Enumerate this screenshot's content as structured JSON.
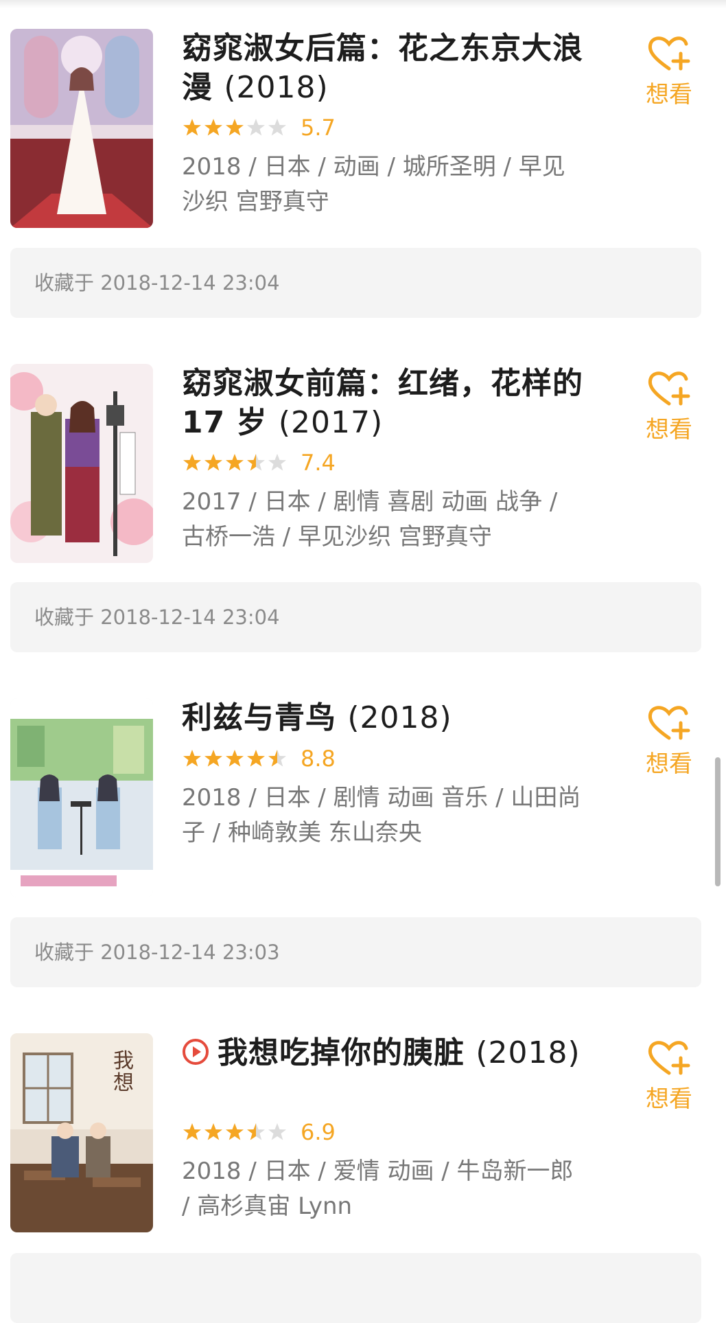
{
  "colors": {
    "accent": "#f5a623",
    "star_empty": "#dcdcdc",
    "play_red": "#e54b3c",
    "collect_bg": "#f4f4f4"
  },
  "icons": {
    "want": "heart-plus-icon",
    "star": "star-icon",
    "play": "play-circle-icon"
  },
  "items": [
    {
      "title": "窈窕淑女后篇：花之东京大浪漫",
      "year": "(2018)",
      "stars": 3,
      "score": "5.7",
      "meta": "2018 / 日本 / 动画 / 城所圣明 / 早见沙织 宫野真守",
      "want_label": "想看",
      "collected": "收藏于 2018-12-14 23:04"
    },
    {
      "title": "窈窕淑女前篇：红绪，花样的 17 岁",
      "year": "(2017)",
      "stars": 3.5,
      "score": "7.4",
      "meta": "2017 / 日本 / 剧情 喜剧 动画 战争 / 古桥一浩 / 早见沙织 宫野真守",
      "want_label": "想看",
      "collected": "收藏于 2018-12-14 23:04"
    },
    {
      "title": "利兹与青鸟",
      "year": "(2018)",
      "stars": 4.5,
      "score": "8.8",
      "meta": "2018 / 日本 / 剧情 动画 音乐 / 山田尚子 / 种崎敦美 东山奈央",
      "want_label": "想看",
      "collected": "收藏于 2018-12-14 23:03"
    },
    {
      "title": "我想吃掉你的胰脏",
      "year": "(2018)",
      "stars": 3.5,
      "score": "6.9",
      "meta": "2018 / 日本 / 爱情 动画 / 牛岛新一郎 / 高杉真宙 Lynn",
      "want_label": "想看",
      "collected": ""
    }
  ]
}
